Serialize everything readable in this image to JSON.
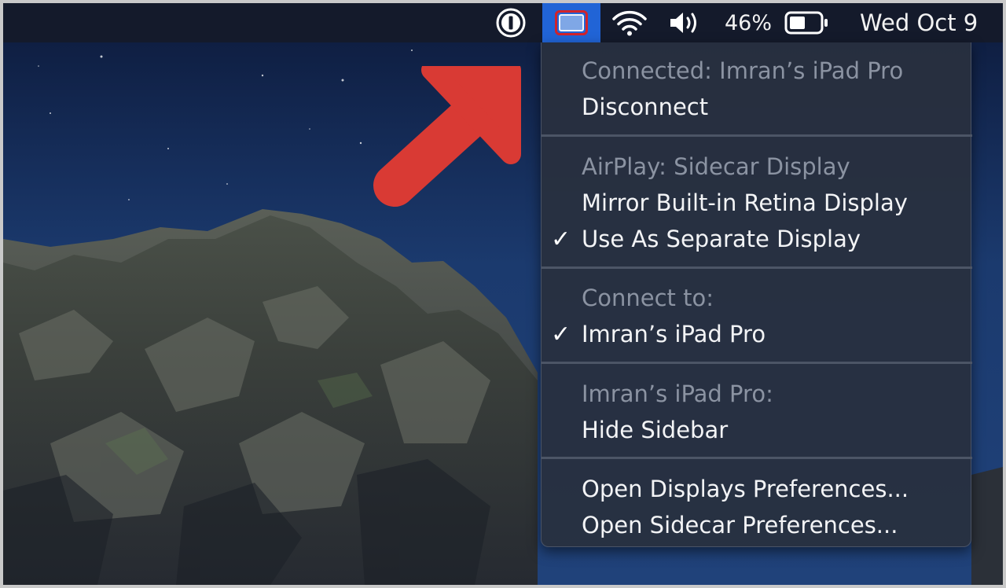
{
  "menubar": {
    "battery_percent": "46%",
    "date": "Wed Oct 9",
    "icons": [
      "1password-icon",
      "sidecar-display-icon",
      "wifi-icon",
      "volume-icon",
      "battery-icon"
    ]
  },
  "menu": {
    "section1_header": "Connected: Imran’s iPad Pro",
    "disconnect": "Disconnect",
    "section2_header": "AirPlay: Sidecar Display",
    "mirror": "Mirror Built-in Retina Display",
    "separate": "Use As Separate Display",
    "separate_checked": true,
    "section3_header": "Connect to:",
    "ipad": "Imran’s iPad Pro",
    "ipad_checked": true,
    "section4_header": "Imran’s iPad Pro:",
    "hide_sidebar": "Hide Sidebar",
    "open_displays": "Open Displays Preferences...",
    "open_sidecar": "Open Sidecar Preferences..."
  },
  "check_glyph": "✓",
  "colors": {
    "accent_highlight": "#2164d6",
    "annotation_arrow": "#d93a34",
    "annotation_box": "#d2232a",
    "menubar_bg": "#141a2b"
  }
}
